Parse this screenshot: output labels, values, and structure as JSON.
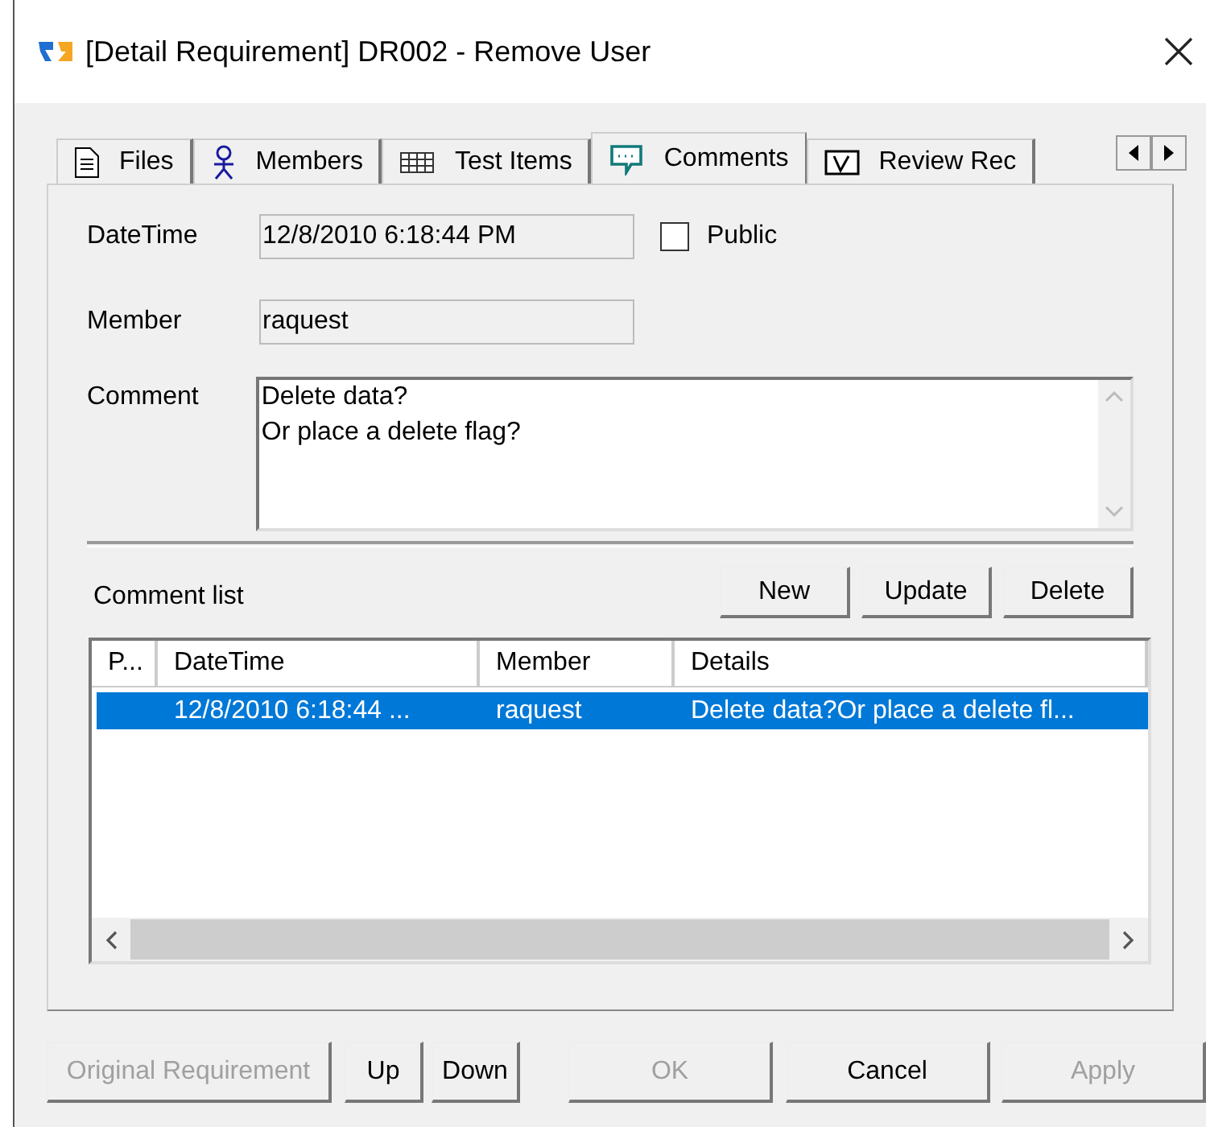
{
  "window": {
    "title": "[Detail Requirement] DR002 - Remove User"
  },
  "tabs": [
    {
      "label": "Files",
      "selected": false
    },
    {
      "label": "Members",
      "selected": false
    },
    {
      "label": "Test Items",
      "selected": false
    },
    {
      "label": "Comments",
      "selected": true
    },
    {
      "label": "Review Rec",
      "selected": false
    }
  ],
  "form": {
    "datetime_label": "DateTime",
    "datetime_value": "12/8/2010 6:18:44 PM",
    "public_label": "Public",
    "public_checked": false,
    "member_label": "Member",
    "member_value": "raquest",
    "comment_label": "Comment",
    "comment_lines": [
      "Delete data?",
      "Or place a delete flag?"
    ]
  },
  "comment_list": {
    "label": "Comment list",
    "buttons": [
      {
        "label": "New",
        "disabled": false
      },
      {
        "label": "Update",
        "disabled": false
      },
      {
        "label": "Delete",
        "disabled": false
      }
    ],
    "columns": [
      "P...",
      "DateTime",
      "Member",
      "Details"
    ],
    "rows": [
      {
        "cells": [
          "",
          "12/8/2010 6:18:44 ...",
          "raquest",
          "Delete data?Or place a delete fl..."
        ],
        "selected": true
      }
    ]
  },
  "footer_buttons": [
    {
      "label": "Original Requirement",
      "disabled": true
    },
    {
      "label": "Up",
      "disabled": false
    },
    {
      "label": "Down",
      "disabled": false
    },
    {
      "label": "OK",
      "disabled": true
    },
    {
      "label": "Cancel",
      "disabled": false
    },
    {
      "label": "Apply",
      "disabled": true
    }
  ]
}
